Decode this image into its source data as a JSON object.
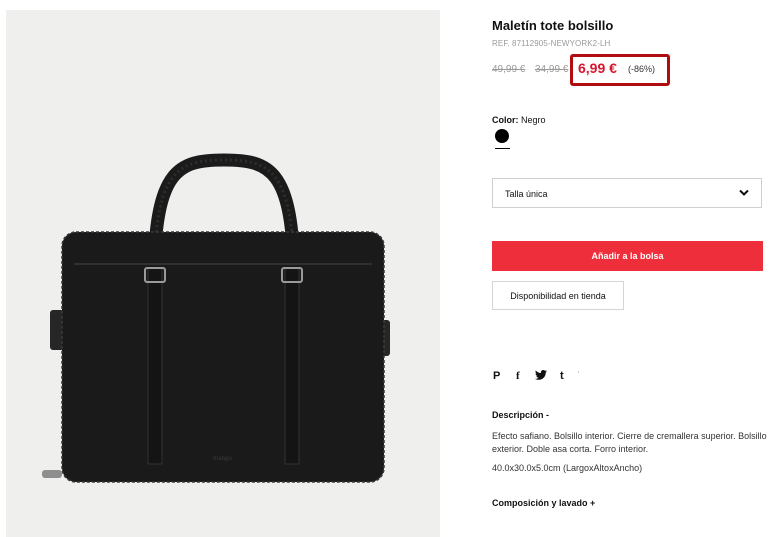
{
  "product": {
    "title": "Maletín tote bolsillo",
    "ref": "REF. 87112905-NEWYORK2-LH",
    "image_alt": "bag-photo"
  },
  "price": {
    "original": "49,99 €",
    "previous": "34,99 €",
    "current": "6,99 €",
    "discount": "(-86%)",
    "highlight_color": "#b10d10",
    "sale_color": "#d9142b"
  },
  "color": {
    "label": "Color:",
    "value": "Negro",
    "swatch": "#000000"
  },
  "size": {
    "selected": "Talla única"
  },
  "actions": {
    "add_to_bag": "Añadir a la bolsa",
    "availability": "Disponibilidad en tienda",
    "button_color": "#ef2e3c"
  },
  "share": {
    "icons": [
      "pinterest-icon",
      "facebook-icon",
      "twitter-icon",
      "tumblr-icon"
    ],
    "pinterest": "P",
    "facebook": "f",
    "twitter": "🐦",
    "tumblr": "t"
  },
  "description": {
    "heading": "Descripción  -",
    "body": "Efecto safiano. Bolsillo interior. Cierre de cremallera superior. Bolsillo exterior. Doble asa corta. Forro interior.",
    "dimensions": "40.0x30.0x5.0cm (LargoxAltoxAncho)"
  },
  "composition": {
    "heading": "Composición y lavado  +"
  }
}
